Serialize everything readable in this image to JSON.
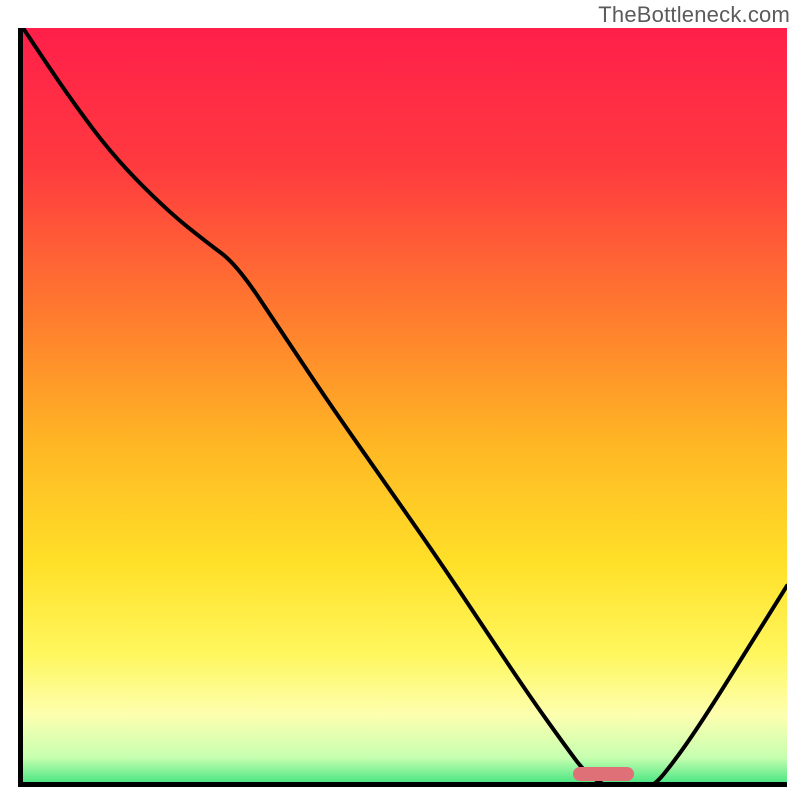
{
  "watermark": "TheBottleneck.com",
  "colors": {
    "axis": "#000000",
    "curve": "#000000",
    "marker": "#e07077",
    "gradient_stops": [
      {
        "offset": 0.0,
        "color": "#ff1f4a"
      },
      {
        "offset": 0.18,
        "color": "#ff3a3f"
      },
      {
        "offset": 0.38,
        "color": "#ff7d2e"
      },
      {
        "offset": 0.55,
        "color": "#ffb824"
      },
      {
        "offset": 0.7,
        "color": "#ffe028"
      },
      {
        "offset": 0.82,
        "color": "#fff75e"
      },
      {
        "offset": 0.9,
        "color": "#fdffb0"
      },
      {
        "offset": 0.955,
        "color": "#c6ffb0"
      },
      {
        "offset": 0.985,
        "color": "#57e887"
      },
      {
        "offset": 1.0,
        "color": "#1fd46a"
      }
    ]
  },
  "chart_data": {
    "type": "line",
    "title": "",
    "xlabel": "",
    "ylabel": "",
    "xlim": [
      0,
      100
    ],
    "ylim": [
      0,
      100
    ],
    "x": [
      0,
      6,
      12,
      19,
      24,
      28,
      34,
      40,
      47,
      54,
      60,
      66,
      71,
      74,
      78,
      82,
      86,
      90,
      95,
      100
    ],
    "y": [
      100,
      91,
      83,
      76,
      72,
      69,
      60,
      51,
      41,
      31,
      22,
      13,
      6,
      2,
      0,
      0,
      5,
      11,
      19,
      27
    ],
    "marker": {
      "x_start": 72,
      "x_end": 80,
      "y": 1
    },
    "annotations": []
  }
}
